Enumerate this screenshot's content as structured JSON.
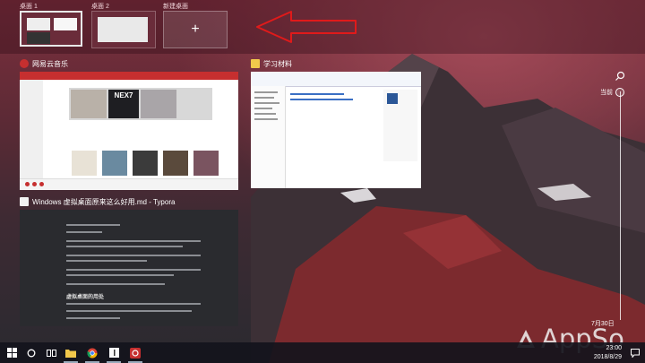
{
  "desktops": [
    {
      "label": "桌面 1",
      "active": true
    },
    {
      "label": "桌面 2",
      "active": false
    },
    {
      "label": "新建桌面",
      "active": false,
      "icon": "plus-icon"
    }
  ],
  "arrow_color": "#e01a1a",
  "windows": {
    "music": {
      "title": "网易云音乐",
      "icon": "netease-music-icon",
      "accent": "#c62f2f",
      "banner_text": "NEX7"
    },
    "explorer": {
      "title": "学习材料",
      "icon": "folder-icon"
    },
    "typora": {
      "title": "Windows 虚拟桌面原来这么好用.md - Typora",
      "icon": "typora-icon",
      "heading": "虚拟桌面的用处"
    }
  },
  "timeline": {
    "icon": "search-icon",
    "now_label": "当前",
    "date_label": "7月30日"
  },
  "taskbar": {
    "items": [
      "windows-start-icon",
      "cortana-icon",
      "task-view-icon",
      "file-explorer-icon",
      "chrome-icon",
      "typora-icon",
      "netease-music-icon"
    ],
    "clock_time": "23:00",
    "clock_date": "2018/8/29",
    "notification_icon": "action-center-icon"
  },
  "watermark": {
    "text": "AppSo",
    "icon": "appso-logo-icon"
  }
}
